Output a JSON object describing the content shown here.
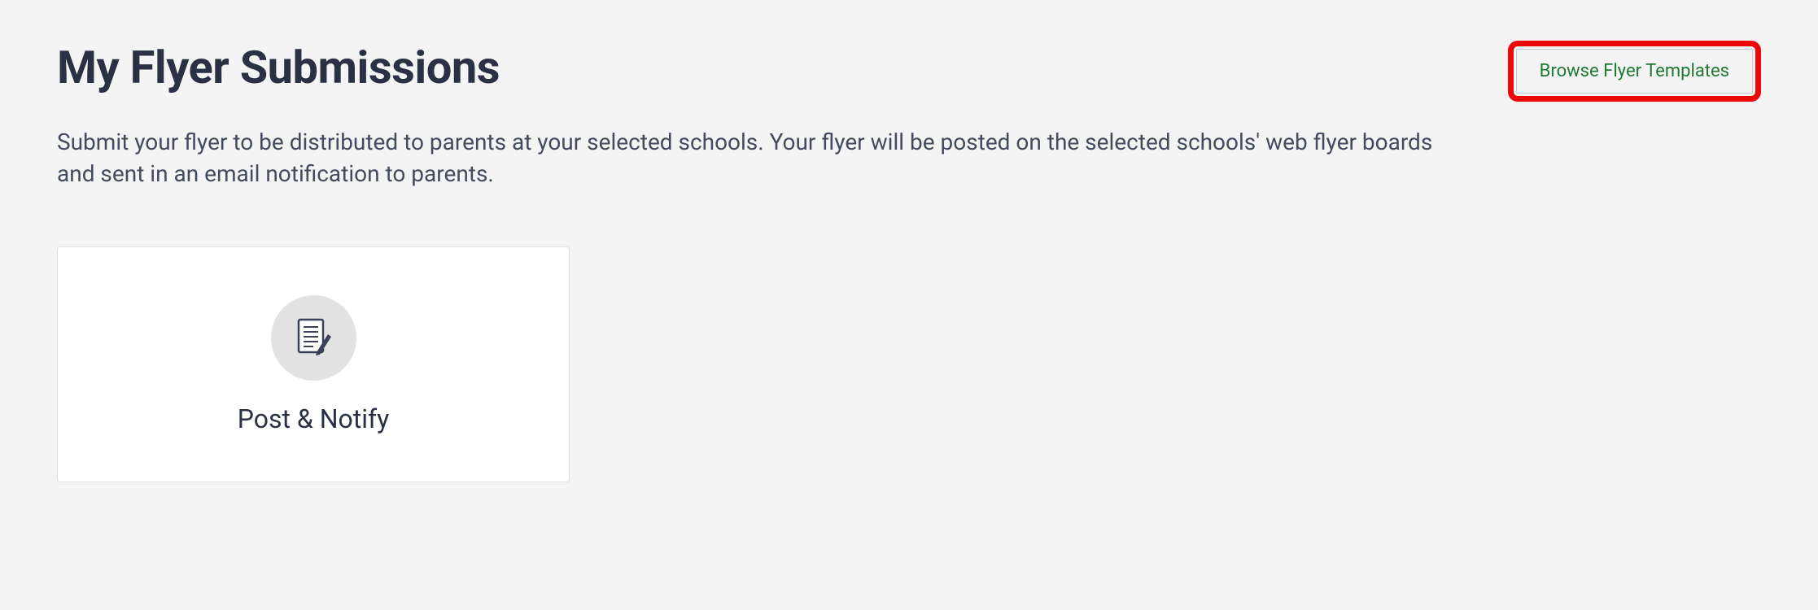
{
  "header": {
    "title": "My Flyer Submissions",
    "browse_button_label": "Browse Flyer Templates"
  },
  "description": "Submit your flyer to be distributed to parents at your selected schools. Your flyer will be posted on the selected schools' web flyer boards and sent in an email notification to parents.",
  "card": {
    "label": "Post & Notify",
    "icon": "document-pencil-icon"
  }
}
